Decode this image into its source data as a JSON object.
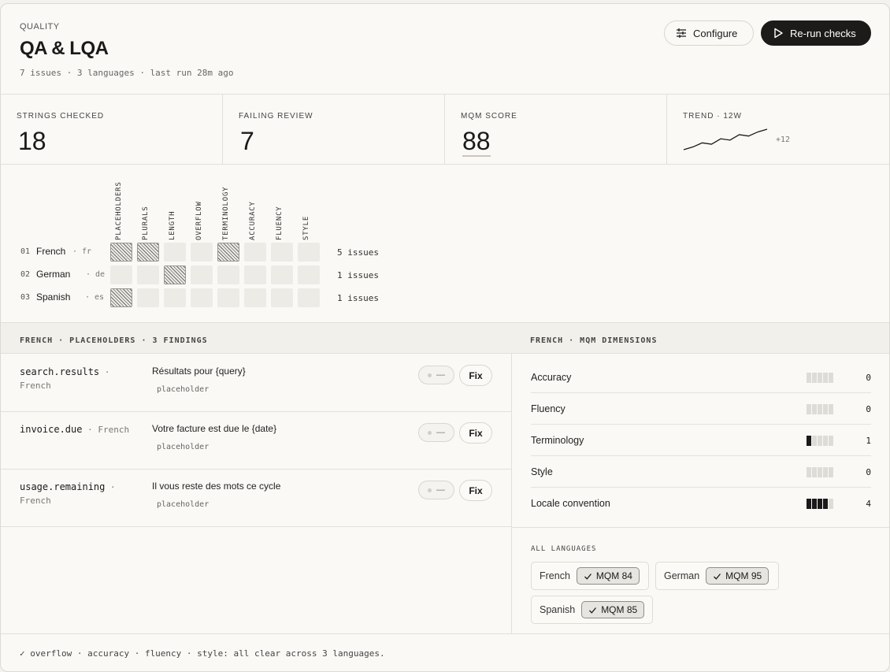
{
  "header": {
    "eyebrow": "QUALITY",
    "title": "QA & LQA",
    "meta": "7 issues · 3 languages · last run 28m ago",
    "configure_label": "Configure",
    "rerun_label": "Re-run checks"
  },
  "stats": [
    {
      "label": "STRINGS CHECKED",
      "value": "18"
    },
    {
      "label": "FAILING REVIEW",
      "value": "7"
    },
    {
      "label": "MQM SCORE",
      "value": "88"
    },
    {
      "label": "TREND · 12W",
      "delta": "+12",
      "values": [
        2,
        4,
        7,
        6,
        10,
        9,
        13,
        12,
        15,
        17
      ]
    }
  ],
  "matrix": {
    "columns": [
      "PLACEHOLDERS",
      "PLURALS",
      "LENGTH",
      "OVERFLOW",
      "TERMINOLOGY",
      "ACCURACY",
      "FLUENCY",
      "STYLE"
    ],
    "rows": [
      {
        "num": "01",
        "name": "French",
        "code": "· fr",
        "count": "5 issues",
        "hits": [
          true,
          true,
          false,
          false,
          true,
          false,
          false,
          false
        ]
      },
      {
        "num": "02",
        "name": "German",
        "code": "· de",
        "count": "1 issues",
        "hits": [
          false,
          false,
          true,
          false,
          false,
          false,
          false,
          false
        ]
      },
      {
        "num": "03",
        "name": "Spanish",
        "code": "· es",
        "count": "1 issues",
        "hits": [
          true,
          false,
          false,
          false,
          false,
          false,
          false,
          false
        ]
      }
    ]
  },
  "findings_title": "FRENCH · PLACEHOLDERS · 3 FINDINGS",
  "findings": [
    {
      "key": "search.results",
      "lang": "French",
      "text": "Résultats pour {query}",
      "tag": "placeholder",
      "toggle": "—",
      "fix": "Fix"
    },
    {
      "key": "invoice.due",
      "lang": "French",
      "text": "Votre facture est due le {date}",
      "tag": "placeholder",
      "toggle": "—",
      "fix": "Fix"
    },
    {
      "key": "usage.remaining",
      "lang": "French",
      "text": "Il vous reste des mots ce cycle",
      "tag": "placeholder",
      "toggle": "—",
      "fix": "Fix"
    }
  ],
  "dimensions_title": "FRENCH · MQM DIMENSIONS",
  "dimensions": [
    {
      "name": "Accuracy",
      "value": "0"
    },
    {
      "name": "Fluency",
      "value": "0"
    },
    {
      "name": "Terminology",
      "value": "1"
    },
    {
      "name": "Style",
      "value": "0"
    },
    {
      "name": "Locale convention",
      "value": "4"
    }
  ],
  "all_languages": {
    "title": "ALL LANGUAGES",
    "items": [
      {
        "name": "French",
        "badge": "MQM 84"
      },
      {
        "name": "German",
        "badge": "MQM 95"
      },
      {
        "name": "Spanish",
        "badge": "MQM 85"
      }
    ]
  },
  "footer": "✓ overflow · accuracy · fluency · style: all clear across 3 languages."
}
